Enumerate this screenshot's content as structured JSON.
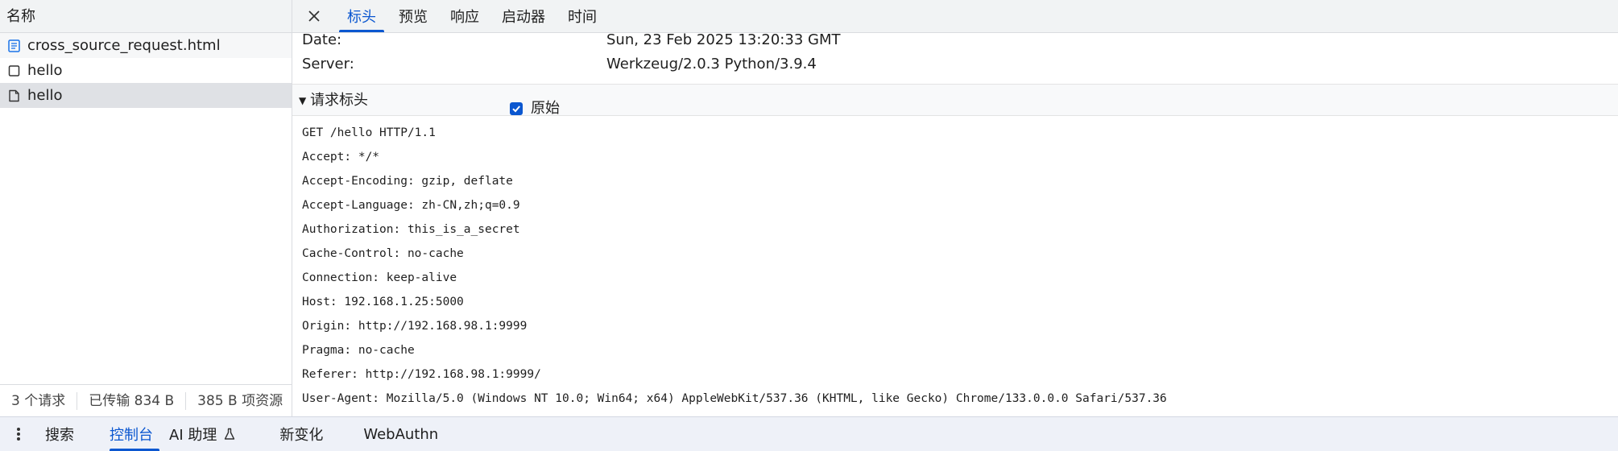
{
  "request_list": {
    "header": "名称",
    "items": [
      {
        "name": "cross_source_request.html",
        "icon": "document-icon"
      },
      {
        "name": "hello",
        "icon": "checkbox-icon"
      },
      {
        "name": "hello",
        "icon": "file-icon"
      }
    ],
    "footer": {
      "requests": "3 个请求",
      "transferred": "已传输 834 B",
      "resources": "385 B 项资源"
    }
  },
  "detail": {
    "tabs": [
      "标头",
      "预览",
      "响应",
      "启动器",
      "时间"
    ],
    "active_tab": "标头",
    "response_headers": [
      {
        "key": "Date:",
        "value": "Sun, 23 Feb 2025 13:20:33 GMT"
      },
      {
        "key": "Server:",
        "value": "Werkzeug/2.0.3 Python/3.9.4"
      }
    ],
    "request_headers_section": {
      "title": "请求标头",
      "raw_label": "原始",
      "raw_checked": true,
      "lines": [
        "GET /hello HTTP/1.1",
        "Accept: */*",
        "Accept-Encoding: gzip, deflate",
        "Accept-Language: zh-CN,zh;q=0.9",
        "Authorization: this_is_a_secret",
        "Cache-Control: no-cache",
        "Connection: keep-alive",
        "Host: 192.168.1.25:5000",
        "Origin: http://192.168.98.1:9999",
        "Pragma: no-cache",
        "Referer: http://192.168.98.1:9999/",
        "User-Agent: Mozilla/5.0 (Windows NT 10.0; Win64; x64) AppleWebKit/537.36 (KHTML, like Gecko) Chrome/133.0.0.0 Safari/537.36"
      ]
    }
  },
  "drawer": {
    "tabs": [
      "搜索",
      "控制台",
      "AI 助理",
      "新变化",
      "WebAuthn"
    ],
    "active_tab": "控制台"
  },
  "colors": {
    "accent": "#0b57d0",
    "selected_row": "#dfe1e5",
    "drawer_bg": "#eef1f8"
  }
}
